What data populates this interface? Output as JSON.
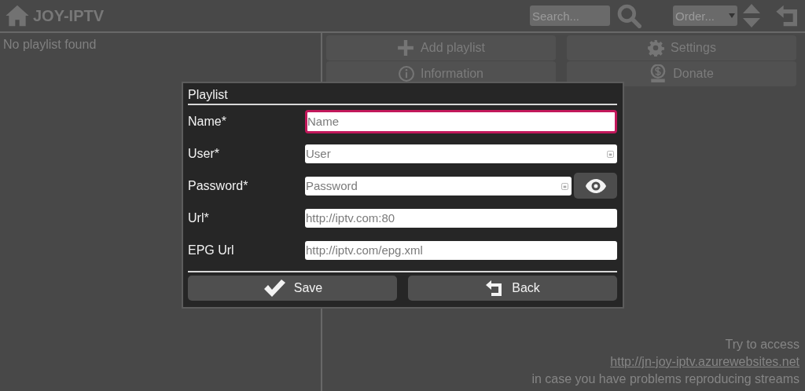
{
  "header": {
    "title": "JOY-IPTV",
    "search": {
      "placeholder": "Search..."
    },
    "order": {
      "value": "Order..."
    }
  },
  "sidebar": {
    "empty_message": "No playlist found"
  },
  "actions": [
    {
      "label": "Add playlist"
    },
    {
      "label": "Settings"
    },
    {
      "label": "Information"
    },
    {
      "label": "Donate"
    }
  ],
  "dialog": {
    "title": "Playlist",
    "fields": [
      {
        "label": "Name*",
        "placeholder": "Name",
        "focused": true,
        "kind": "text"
      },
      {
        "label": "User*",
        "placeholder": "User",
        "focused": false,
        "kind": "credential"
      },
      {
        "label": "Password*",
        "placeholder": "Password",
        "focused": false,
        "kind": "password"
      },
      {
        "label": "Url*",
        "placeholder": "http://iptv.com:80",
        "focused": false,
        "kind": "text"
      },
      {
        "label": "EPG Url",
        "placeholder": "http://iptv.com/epg.xml",
        "focused": false,
        "kind": "text"
      }
    ],
    "buttons": [
      {
        "label": "Save"
      },
      {
        "label": "Back"
      }
    ]
  },
  "footer": {
    "lines": [
      {
        "kind": "text",
        "text": "Try to access"
      },
      {
        "kind": "link",
        "text": "http://jn-joy-iptv.azurewebsites.net"
      },
      {
        "kind": "text",
        "text": "in case you have problems reproducing streams"
      }
    ]
  }
}
